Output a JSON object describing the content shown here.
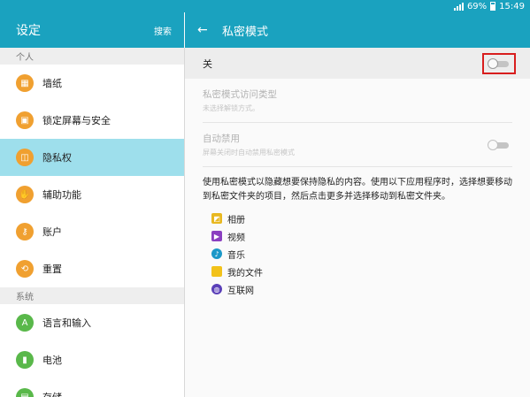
{
  "status_bar": {
    "battery": "69%",
    "time": "15:49"
  },
  "left_header": {
    "title": "设定",
    "search": "搜索"
  },
  "right_header": {
    "back_icon": "←",
    "title": "私密模式"
  },
  "sidebar": {
    "sections": [
      {
        "label": "个人",
        "items": [
          {
            "label": "墙纸",
            "icon": "wallpaper-icon",
            "glyph": "▦",
            "color": "#f0a030",
            "active": false
          },
          {
            "label": "锁定屏幕与安全",
            "icon": "lock-icon",
            "glyph": "▣",
            "color": "#f0a030",
            "active": false
          },
          {
            "label": "隐私权",
            "icon": "privacy-icon",
            "glyph": "◫",
            "color": "#f0a030",
            "active": true
          },
          {
            "label": "辅助功能",
            "icon": "hand-icon",
            "glyph": "✋",
            "color": "#f0a030",
            "active": false
          },
          {
            "label": "账户",
            "icon": "key-icon",
            "glyph": "⚷",
            "color": "#f0a030",
            "active": false
          },
          {
            "label": "重置",
            "icon": "reset-icon",
            "glyph": "⟲",
            "color": "#f0a030",
            "active": false
          }
        ]
      },
      {
        "label": "系统",
        "items": [
          {
            "label": "语言和输入",
            "icon": "language-icon",
            "glyph": "A",
            "color": "#59b84a",
            "active": false
          },
          {
            "label": "电池",
            "icon": "battery-icon",
            "glyph": "▮",
            "color": "#59b84a",
            "active": false
          },
          {
            "label": "存储",
            "icon": "storage-icon",
            "glyph": "▤",
            "color": "#59b84a",
            "active": false
          }
        ]
      }
    ]
  },
  "master": {
    "label": "关",
    "state": "off"
  },
  "settings": {
    "access_type": {
      "label": "私密模式访问类型",
      "sub": "未选择解锁方式。"
    },
    "auto_disable": {
      "label": "自动禁用",
      "sub": "屏幕关闭时自动禁用私密模式",
      "state": "off"
    }
  },
  "description": "使用私密模式以隐藏想要保持隐私的内容。使用以下应用程序时，选择想要移动到私密文件夹的项目，然后点击更多并选择移动到私密文件夹。",
  "apps": [
    {
      "label": "相册",
      "icon": "gallery-icon",
      "color": "#e8b820",
      "glyph": "◩"
    },
    {
      "label": "视频",
      "icon": "video-icon",
      "color": "#8a3fc0",
      "glyph": "▶"
    },
    {
      "label": "音乐",
      "icon": "music-icon",
      "color": "#1a98c8",
      "glyph": "♪"
    },
    {
      "label": "我的文件",
      "icon": "folder-icon",
      "color": "#f2c21a",
      "glyph": ""
    },
    {
      "label": "互联网",
      "icon": "internet-icon",
      "color": "#5a3fb8",
      "glyph": "◍"
    }
  ]
}
